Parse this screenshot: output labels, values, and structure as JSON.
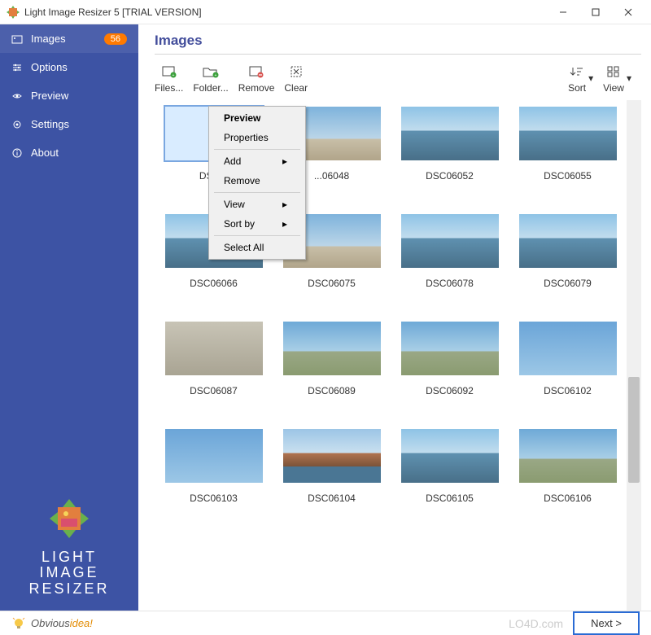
{
  "window": {
    "title": "Light Image Resizer 5   [TRIAL VERSION]"
  },
  "sidebar": {
    "items": [
      {
        "label": "Images",
        "badge": "56"
      },
      {
        "label": "Options"
      },
      {
        "label": "Preview"
      },
      {
        "label": "Settings"
      },
      {
        "label": "About"
      }
    ],
    "brand_line1": "LIGHT",
    "brand_line2": "IMAGE",
    "brand_line3": "RESIZER"
  },
  "page": {
    "title": "Images"
  },
  "toolbar": {
    "files": "Files...",
    "folder": "Folder...",
    "remove": "Remove",
    "clear": "Clear",
    "sort": "Sort",
    "view": "View"
  },
  "context_menu": {
    "preview": "Preview",
    "properties": "Properties",
    "add": "Add",
    "remove": "Remove",
    "view": "View",
    "sort_by": "Sort by",
    "select_all": "Select All"
  },
  "thumbnails": [
    {
      "caption": "DSC...",
      "cls": "ph-stone",
      "selected": true
    },
    {
      "caption": "...06048",
      "cls": "ph-city"
    },
    {
      "caption": "DSC06052",
      "cls": "ph-water"
    },
    {
      "caption": "DSC06055",
      "cls": "ph-water"
    },
    {
      "caption": "DSC06066",
      "cls": "ph-water"
    },
    {
      "caption": "DSC06075",
      "cls": "ph-city"
    },
    {
      "caption": "DSC06078",
      "cls": "ph-water"
    },
    {
      "caption": "DSC06079",
      "cls": "ph-water"
    },
    {
      "caption": "DSC06087",
      "cls": "ph-stone"
    },
    {
      "caption": "DSC06089",
      "cls": "ph-sky"
    },
    {
      "caption": "DSC06092",
      "cls": "ph-sky"
    },
    {
      "caption": "DSC06102",
      "cls": "ph-statue"
    },
    {
      "caption": "DSC06103",
      "cls": "ph-statue"
    },
    {
      "caption": "DSC06104",
      "cls": "ph-bridge"
    },
    {
      "caption": "DSC06105",
      "cls": "ph-water"
    },
    {
      "caption": "DSC06106",
      "cls": "ph-sky"
    }
  ],
  "footer": {
    "brand_a": "Obvious",
    "brand_b": "idea",
    "brand_excl": "!",
    "watermark": "LO4D.com",
    "next": "Next >"
  }
}
